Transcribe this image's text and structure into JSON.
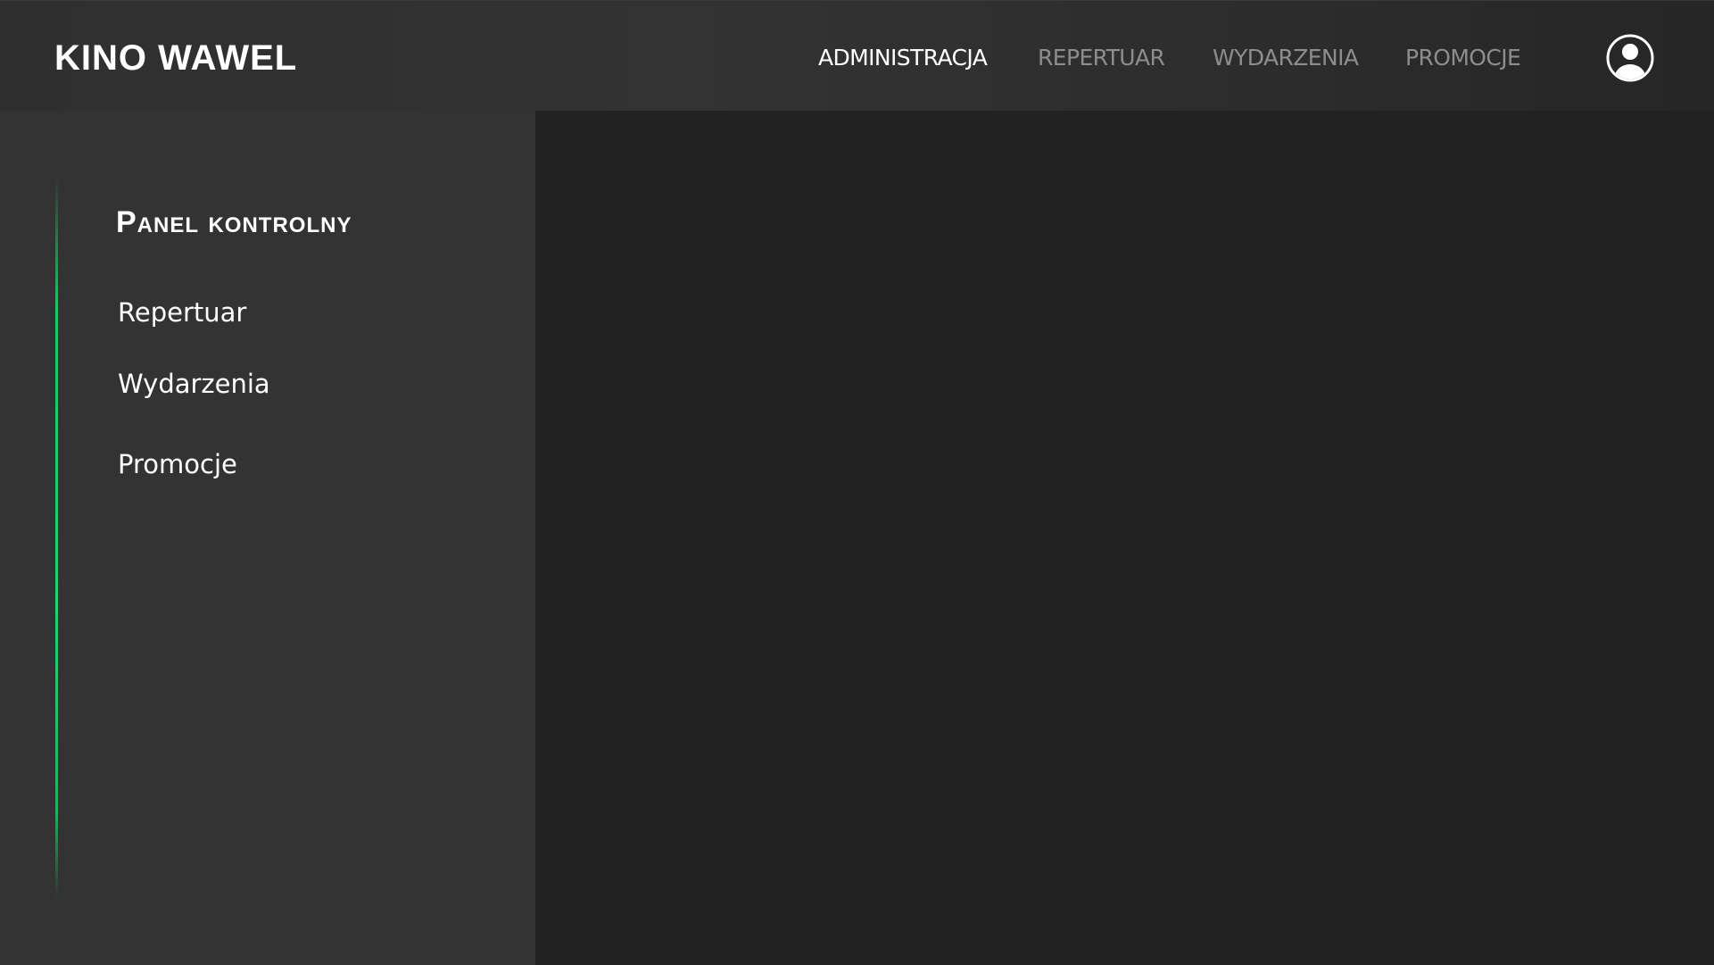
{
  "header": {
    "brand": "KINO WAWEL",
    "nav": [
      {
        "label": "ADMINISTRACJA",
        "active": true
      },
      {
        "label": "REPERTUAR",
        "active": false
      },
      {
        "label": "WYDARZENIA",
        "active": false
      },
      {
        "label": "PROMOCJE",
        "active": false
      }
    ],
    "user_icon": "user-circle-icon"
  },
  "sidebar": {
    "title": "Panel kontrolny",
    "items": [
      {
        "label": "Repertuar"
      },
      {
        "label": "Wydarzenia"
      },
      {
        "label": "Promocje"
      }
    ],
    "accent_color": "#22c55e"
  },
  "colors": {
    "header_bg": "#303030",
    "sidebar_bg": "#333333",
    "content_bg": "#222222",
    "nav_inactive": "#8d8d8d",
    "text": "#ffffff"
  }
}
